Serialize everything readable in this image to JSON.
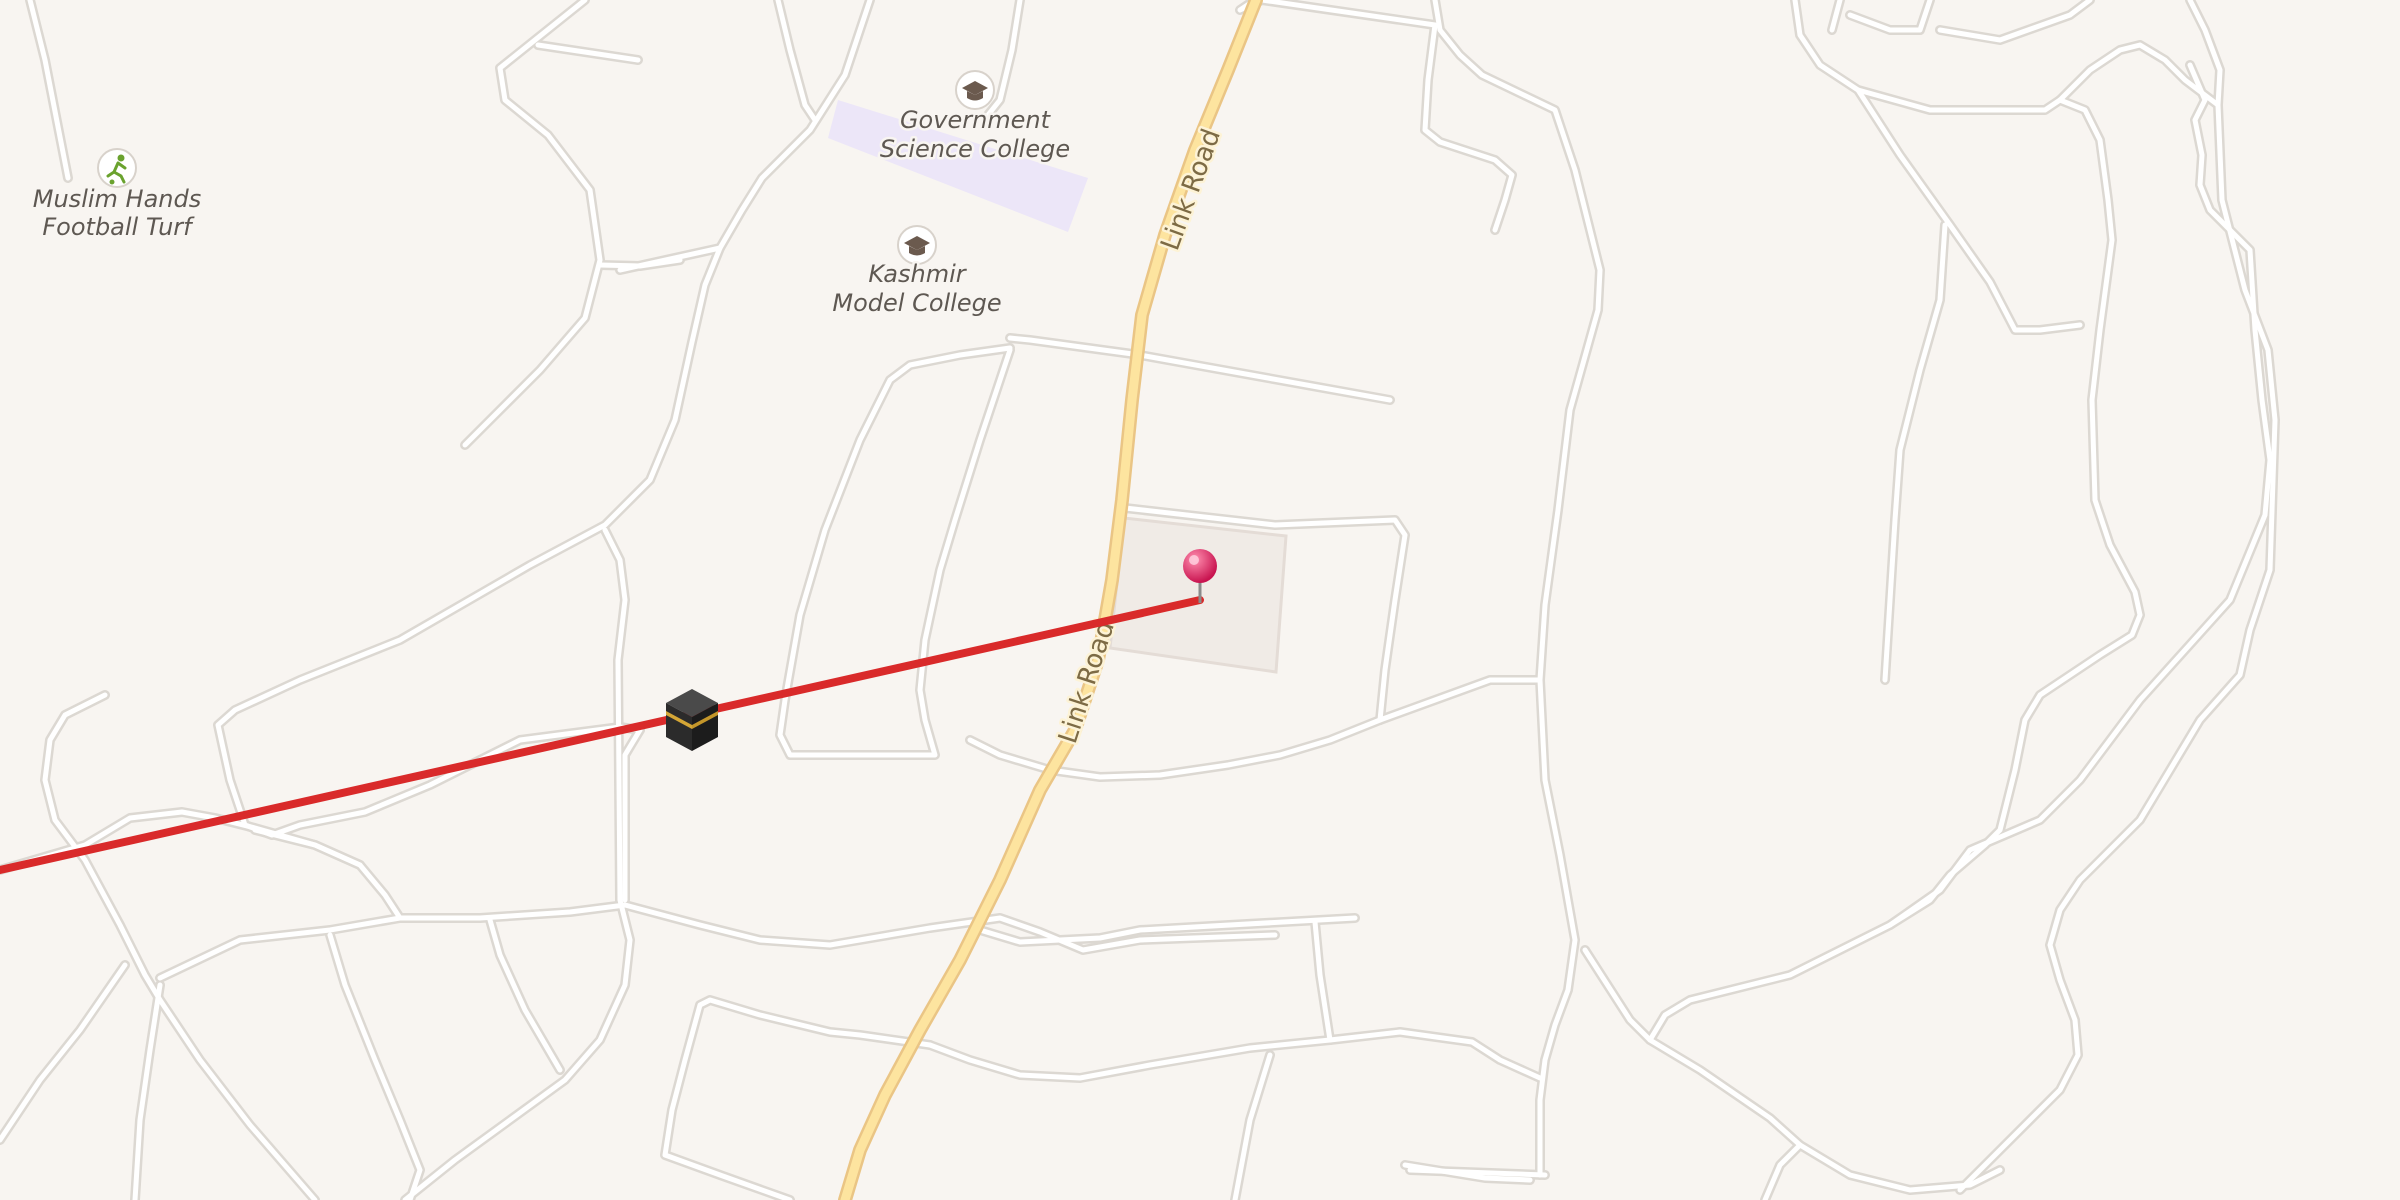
{
  "map": {
    "pois": [
      {
        "id": "turf",
        "label_lines": [
          "Muslim Hands",
          "Football Turf"
        ],
        "icon": "football-player-icon"
      },
      {
        "id": "gov-college",
        "label_lines": [
          "Government",
          "Science College"
        ],
        "icon": "graduation-cap-icon"
      },
      {
        "id": "kashmir-college",
        "label_lines": [
          "Kashmir",
          "Model College"
        ],
        "icon": "graduation-cap-icon"
      }
    ],
    "road_labels": [
      "Link Road",
      "Link Road"
    ],
    "markers": {
      "destination": {
        "icon": "map-pin-icon",
        "color": "#e8336d"
      },
      "qibla": {
        "icon": "kaaba-icon"
      }
    },
    "colors": {
      "background": "#f8f5f1",
      "road_casing": "#dcd8d2",
      "road_fill": "#ffffff",
      "major_road_casing": "#eac585",
      "major_road_fill": "#fde49f",
      "campus_area": "#ece6f8",
      "building_area": "#f0ebe6",
      "qibla_line": "#d92a2a"
    }
  }
}
